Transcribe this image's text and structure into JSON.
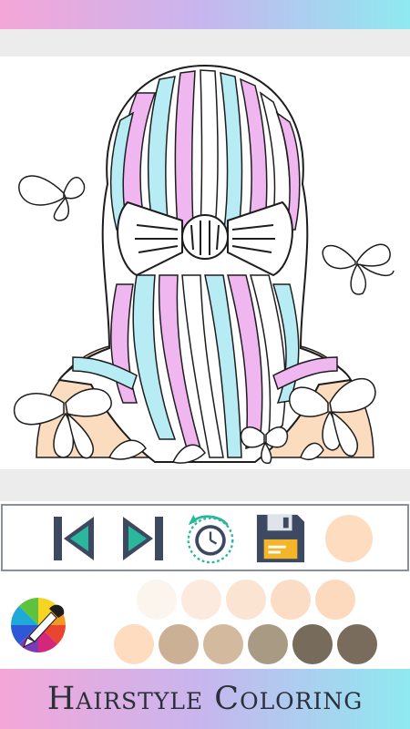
{
  "app": {
    "title": "Hairstyle Coloring"
  },
  "toolbar": {
    "items": [
      {
        "name": "previous-button",
        "icon": "skip-previous-icon"
      },
      {
        "name": "next-button",
        "icon": "skip-next-icon"
      },
      {
        "name": "history-button",
        "icon": "clock-history-icon"
      },
      {
        "name": "save-button",
        "icon": "floppy-disk-icon"
      },
      {
        "name": "selected-color-button",
        "icon": "selected-color-indicator"
      }
    ],
    "selected_color": "#fddcbf"
  },
  "palette": {
    "wheel_icon": "color-wheel-picker-icon",
    "row1": [
      "#fcf5ee",
      "#fbeadd",
      "#fbe4d1",
      "#fbdcc4",
      "#fdd9bd"
    ],
    "row2": [
      "#fddcc0",
      "#cbb095",
      "#d3b99d",
      "#a99a84",
      "#776b5c",
      "#7a6c5d"
    ]
  },
  "colors": {
    "pink": "#f0b6f0",
    "blue": "#b7ecf4",
    "skin": "#fcdcbe",
    "outline": "#1d1d1d",
    "toolbar_dark": "#3c4960",
    "toolbar_green": "#2bb79b"
  }
}
